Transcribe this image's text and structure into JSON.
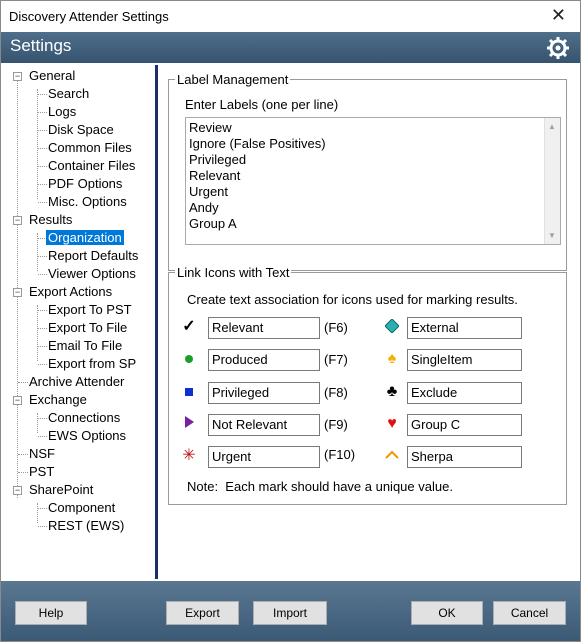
{
  "window": {
    "title": "Discovery Attender Settings",
    "close_glyph": "✕"
  },
  "header": {
    "title": "Settings",
    "icon": "gear-icon"
  },
  "tree": {
    "general": "General",
    "search": "Search",
    "logs": "Logs",
    "disk_space": "Disk Space",
    "common_files": "Common Files",
    "container_files": "Container Files",
    "pdf_options": "PDF Options",
    "misc_options": "Misc. Options",
    "results": "Results",
    "organization": "Organization",
    "report_defaults": "Report Defaults",
    "viewer_options": "Viewer Options",
    "export_actions": "Export Actions",
    "export_to_pst": "Export To PST",
    "export_to_file": "Export To File",
    "email_to_file": "Email To File",
    "export_from_sp": "Export from SP",
    "archive_attender": "Archive Attender",
    "exchange": "Exchange",
    "connections": "Connections",
    "ews_options": "EWS Options",
    "nsf": "NSF",
    "pst": "PST",
    "sharepoint": "SharePoint",
    "component": "Component",
    "rest_ews": "REST (EWS)"
  },
  "label_management": {
    "legend": "Label Management",
    "instructions": "Enter Labels (one per line)",
    "labels": [
      "Review",
      "Ignore (False Positives)",
      "Privileged",
      "Relevant",
      "Urgent",
      "Andy",
      "Group A"
    ]
  },
  "link_icons": {
    "legend": "Link Icons with Text",
    "instructions": "Create text association for icons used for marking results.",
    "left": [
      {
        "icon": "checkmark-icon",
        "value": "Relevant",
        "key": "(F6)"
      },
      {
        "icon": "green-dot-icon",
        "value": "Produced",
        "key": "(F7)"
      },
      {
        "icon": "blue-square-icon",
        "value": "Privileged",
        "key": "(F8)"
      },
      {
        "icon": "purple-triangle-icon",
        "value": "Not Relevant",
        "key": "(F9)"
      },
      {
        "icon": "red-asterisk-icon",
        "value": "Urgent",
        "key": "(F10)"
      }
    ],
    "right": [
      {
        "icon": "teal-diamond-icon",
        "value": "External"
      },
      {
        "icon": "yellow-spade-icon",
        "value": "SingleItem"
      },
      {
        "icon": "black-club-icon",
        "value": "Exclude"
      },
      {
        "icon": "red-heart-icon",
        "value": "Group C"
      },
      {
        "icon": "orange-chevron-icon",
        "value": "Sherpa"
      }
    ],
    "note": "Note:  Each mark should have a unique value."
  },
  "buttons": {
    "help": "Help",
    "export": "Export",
    "import": "Import",
    "ok": "OK",
    "cancel": "Cancel"
  },
  "colors": {
    "header": "#3f5e7a",
    "tree_selection": "#0078d7",
    "divider": "#1a2f6b"
  }
}
